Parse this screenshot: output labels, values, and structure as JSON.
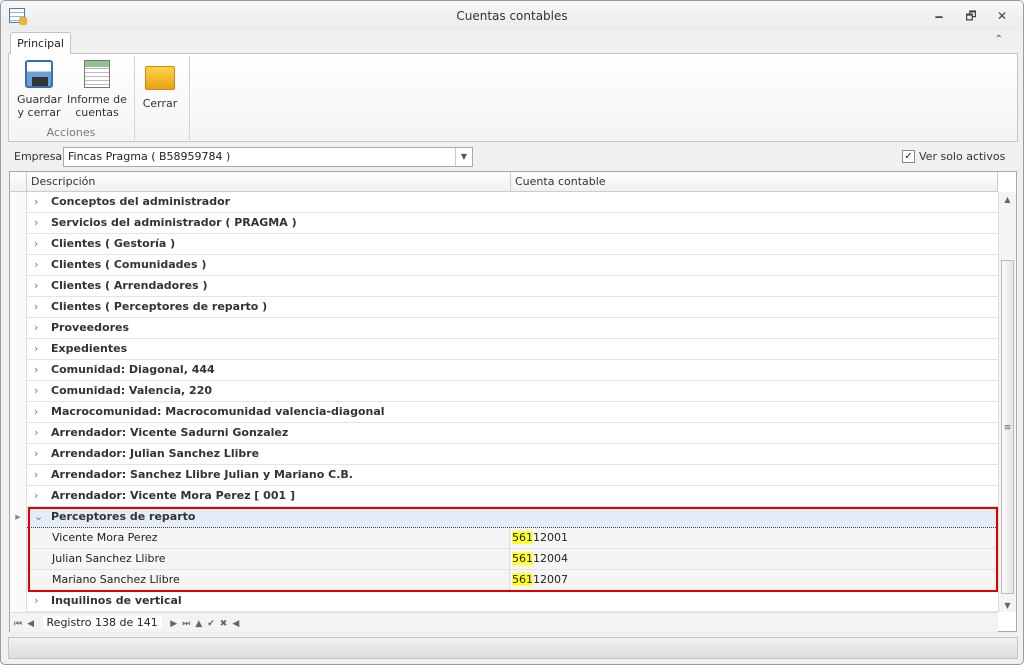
{
  "window": {
    "title": "Cuentas contables",
    "minimize": "🗕",
    "restore": "🗗",
    "close": "✕"
  },
  "ribbon": {
    "tab": "Principal",
    "collapse": "⌃",
    "buttons": [
      {
        "l1": "Guardar",
        "l2": "y cerrar"
      },
      {
        "l1": "Informe de",
        "l2": "cuentas"
      },
      {
        "l1": "Cerrar",
        "l2": ""
      }
    ],
    "group": "Acciones"
  },
  "filter": {
    "empresa_label": "Empresa:",
    "empresa_value": "Fincas Pragma ( B58959784 )",
    "solo_activos_label": "Ver solo activos",
    "solo_activos_checked": true
  },
  "grid": {
    "columns": [
      "Descripción",
      "Cuenta contable"
    ],
    "groups_before": [
      "Conceptos del administrador",
      "Servicios del administrador ( PRAGMA )",
      "Clientes ( Gestoría )",
      "Clientes ( Comunidades )",
      "Clientes ( Arrendadores )",
      "Clientes ( Perceptores de reparto )",
      "Proveedores",
      "Expedientes",
      "Comunidad: Diagonal, 444",
      "Comunidad: Valencia, 220",
      "Macrocomunidad: Macrocomunidad valencia-diagonal",
      "Arrendador: Vicente Sadurni Gonzalez",
      "Arrendador: Julian Sanchez Llibre",
      "Arrendador: Sanchez Llibre Julian y Mariano C.B.",
      "Arrendador: Vicente Mora Perez [ 001 ]"
    ],
    "expanded_group": "Perceptores de reparto",
    "children": [
      {
        "name": "Vicente Mora Perez",
        "prefix": "561",
        "rest": "12001"
      },
      {
        "name": "Julian Sanchez Llibre",
        "prefix": "561",
        "rest": "12004"
      },
      {
        "name": "Mariano Sanchez Llibre",
        "prefix": "561",
        "rest": "12007"
      }
    ],
    "group_after": "Inquilinos de vertical",
    "navigator": "Registro 138 de 141"
  },
  "colors": {
    "highlight": "#ffff33",
    "selection_border": "#e00000"
  }
}
